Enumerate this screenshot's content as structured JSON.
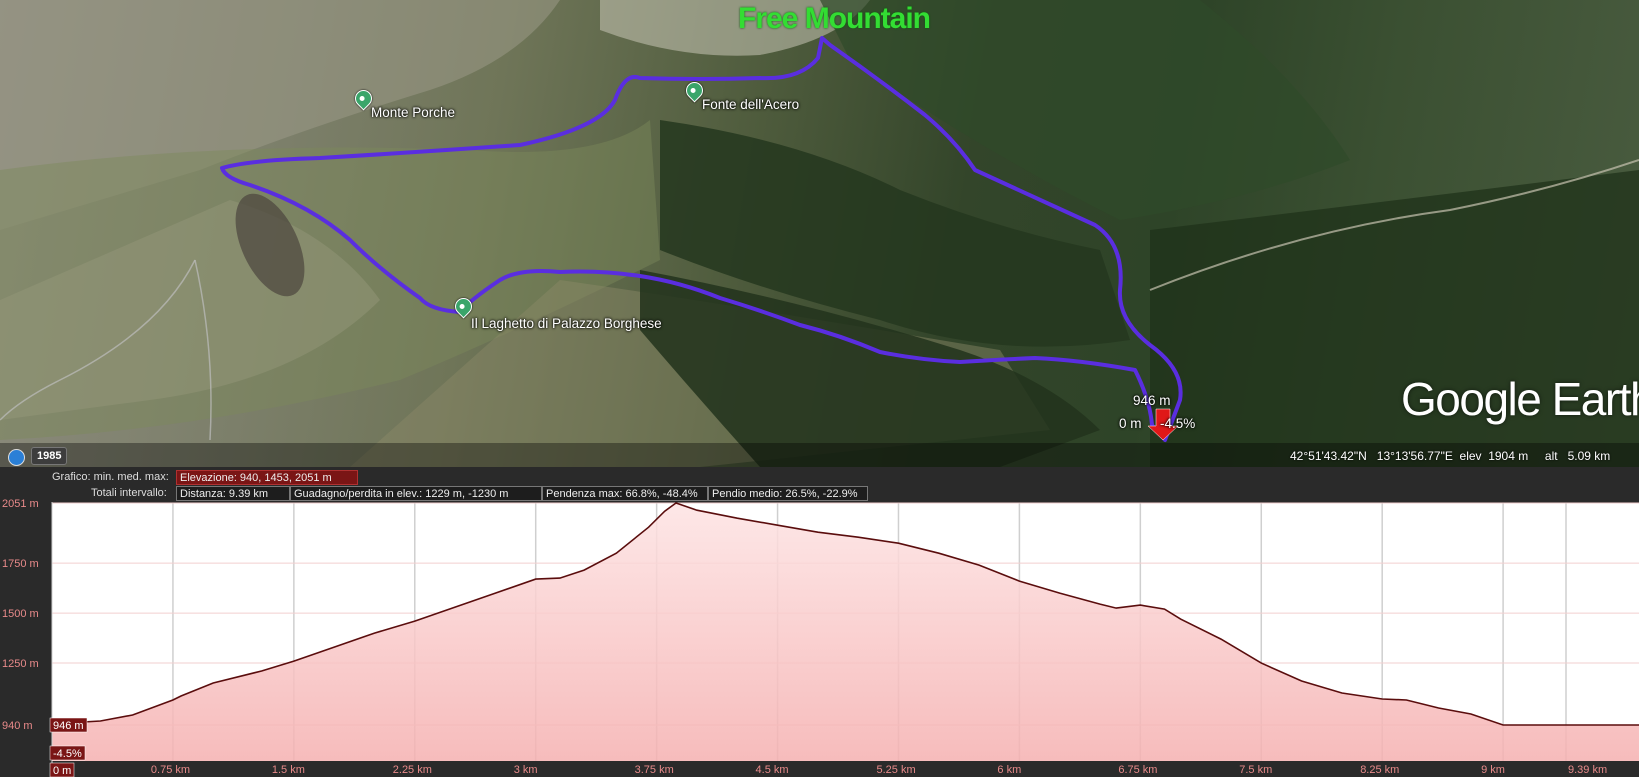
{
  "map": {
    "watermark": "Free Mountain",
    "pois": [
      {
        "label": "Monte Porche",
        "icon": "mountain-peak-icon"
      },
      {
        "label": "Fonte dell'Acero",
        "icon": "hiker-icon"
      },
      {
        "label": "Il Laghetto di Palazzo Borghese",
        "icon": "hiker-icon"
      }
    ],
    "cursor": {
      "elevation": "946 m",
      "distance": "0 m",
      "slope": "-4.5%"
    },
    "brand": "Google Earth",
    "history_year": "1985",
    "status": {
      "lat": "42°51'43.42\"N",
      "lon": "13°13'56.77\"E",
      "elev_label": "elev",
      "elev": "1904 m",
      "alt_label": "alt",
      "alt": "5.09 km"
    },
    "track_color": "#5a2ee0"
  },
  "profile": {
    "row1": {
      "label": "Grafico: min. med. max:",
      "elevation": "Elevazione: 940, 1453, 2051 m"
    },
    "row2": {
      "label": "Totali intervallo:",
      "distance": "Distanza: 9.39 km",
      "gain": "Guadagno/perdita in elev.: 1229 m, -1230 m",
      "max_slope": "Pendenza max: 66.8%, -48.4%",
      "avg_slope": "Pendio medio: 26.5%, -22.9%"
    },
    "cursor_labels": {
      "elev": "946 m",
      "slope": "-4.5%",
      "dist": "0 m"
    }
  },
  "chart_data": {
    "type": "area",
    "title": "",
    "xlabel": "",
    "ylabel": "",
    "x_unit": "km",
    "y_unit": "m",
    "xlim": [
      0,
      9.39
    ],
    "ylim": [
      940,
      2051
    ],
    "x_ticks": [
      "0.75 km",
      "1.5 km",
      "2.25 km",
      "3 km",
      "3.75 km",
      "4.5 km",
      "5.25 km",
      "6 km",
      "6.75 km",
      "7.5 km",
      "8.25 km",
      "9 km",
      "9.39 km"
    ],
    "x_tick_values": [
      0.75,
      1.5,
      2.25,
      3,
      3.75,
      4.5,
      5.25,
      6,
      6.75,
      7.5,
      8.25,
      9,
      9.39
    ],
    "y_ticks": [
      "2051 m",
      "1750 m",
      "1500 m",
      "1250 m",
      "940 m"
    ],
    "y_tick_values": [
      2051,
      1750,
      1500,
      1250,
      940
    ],
    "grid": true,
    "fill_color": "#f5b0b0",
    "line_color": "#5a0d0d",
    "series": [
      {
        "x": [
          0,
          0.3,
          0.5,
          0.75,
          0.8,
          1.0,
          1.3,
          1.5,
          1.75,
          2.0,
          2.25,
          2.5,
          2.75,
          3.0,
          3.15,
          3.3,
          3.5,
          3.7,
          3.8,
          3.87,
          4.0,
          4.25,
          4.5,
          4.75,
          5.0,
          5.25,
          5.5,
          5.75,
          6.0,
          6.25,
          6.5,
          6.6,
          6.75,
          6.9,
          7.0,
          7.25,
          7.5,
          7.75,
          8.0,
          8.25,
          8.4,
          8.6,
          8.8,
          9.0,
          9.2,
          9.39
        ],
        "y": [
          946,
          960,
          990,
          1065,
          1085,
          1150,
          1210,
          1260,
          1330,
          1400,
          1460,
          1530,
          1600,
          1670,
          1675,
          1715,
          1800,
          1930,
          2010,
          2051,
          2015,
          1975,
          1940,
          1905,
          1880,
          1850,
          1800,
          1740,
          1660,
          1600,
          1545,
          1525,
          1540,
          1520,
          1470,
          1370,
          1250,
          1160,
          1100,
          1070,
          1065,
          1025,
          995,
          940,
          940,
          940
        ]
      }
    ]
  }
}
